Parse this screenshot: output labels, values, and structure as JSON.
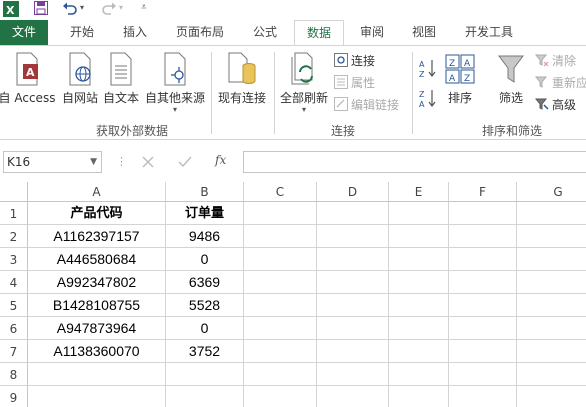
{
  "colors": {
    "excel_green": "#217346",
    "accent": "#2b579a",
    "grid_line": "#d4d4d4"
  },
  "titlebar": {
    "icons": [
      "excel-logo-icon",
      "save-icon",
      "undo-icon",
      "redo-icon",
      "customize-toolbar-icon"
    ]
  },
  "tabs": [
    {
      "label": "文件"
    },
    {
      "label": "开始"
    },
    {
      "label": "插入"
    },
    {
      "label": "页面布局"
    },
    {
      "label": "公式"
    },
    {
      "label": "数据"
    },
    {
      "label": "审阅"
    },
    {
      "label": "视图"
    },
    {
      "label": "开发工具"
    }
  ],
  "active_tab": "数据",
  "ribbon": {
    "get_external": {
      "access": "自 Access",
      "web": "自网站",
      "text": "自文本",
      "other": "自其他来源",
      "group_label": "获取外部数据"
    },
    "existing_conn": "现有连接",
    "connections": {
      "refresh_all": "全部刷新",
      "connect": "连接",
      "properties": "属性",
      "edit_links": "编辑链接",
      "group_label": "连接"
    },
    "sort_filter": {
      "sort": "排序",
      "filter": "筛选",
      "clear": "清除",
      "reapply": "重新应",
      "advanced": "高级",
      "group_label": "排序和筛选"
    }
  },
  "formula_bar": {
    "name_box": "K16",
    "fx": "fx",
    "formula": ""
  },
  "sheet": {
    "columns": [
      "A",
      "B",
      "C",
      "D",
      "E",
      "F",
      "G"
    ],
    "rows": [
      "1",
      "2",
      "3",
      "4",
      "5",
      "6",
      "7",
      "8",
      "9"
    ],
    "cells": [
      [
        "产品代码",
        "订单量"
      ],
      [
        "A1162397157",
        "9486"
      ],
      [
        "A446580684",
        "0"
      ],
      [
        "A992347802",
        "6369"
      ],
      [
        "B1428108755",
        "5528"
      ],
      [
        "A947873964",
        "0"
      ],
      [
        "A1138360070",
        "3752"
      ],
      [
        "",
        ""
      ],
      [
        "",
        ""
      ]
    ]
  }
}
